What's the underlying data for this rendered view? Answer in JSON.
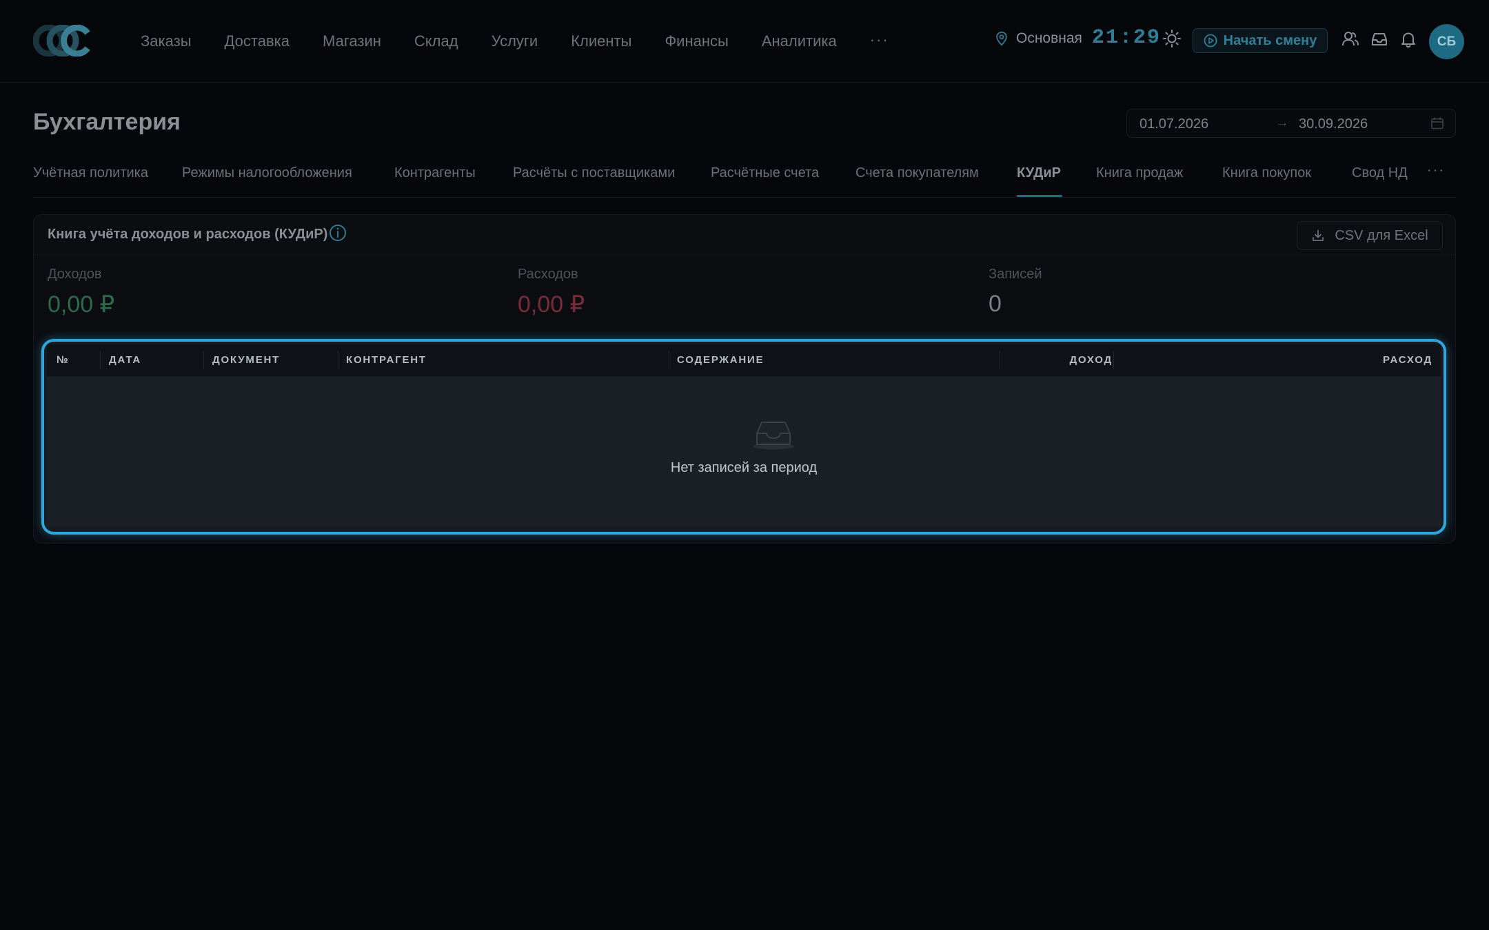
{
  "app": {
    "logo_text": "CCC"
  },
  "nav": {
    "items": [
      "Заказы",
      "Доставка",
      "Магазин",
      "Склад",
      "Услуги",
      "Клиенты",
      "Финансы",
      "Аналитика"
    ],
    "more_label": "···"
  },
  "header": {
    "branch": "Основная",
    "clock": "21:29",
    "start_shift_label": "Начать смену",
    "avatar_initials": "СБ"
  },
  "page": {
    "title": "Бухгалтерия",
    "date_from": "01.07.2026",
    "date_arrow": "→",
    "date_to": "30.09.2026"
  },
  "tabs": {
    "items": [
      "Учётная политика",
      "Режимы налогообложения",
      "Контрагенты",
      "Расчёты с поставщиками",
      "Расчётные счета",
      "Счета покупателям",
      "КУДиР",
      "Книга продаж",
      "Книга покупок",
      "Свод НД"
    ],
    "active": "КУДиР",
    "more_label": "···"
  },
  "panel": {
    "title": "Книга учёта доходов и расходов (КУДиР)",
    "export_label": "CSV для Excel",
    "stats": {
      "income_label": "Доходов",
      "income_value": "0,00 ₽",
      "expense_label": "Расходов",
      "expense_value": "0,00 ₽",
      "count_label": "Записей",
      "count_value": "0"
    }
  },
  "table": {
    "columns": [
      "№",
      "ДАТА",
      "ДОКУМЕНТ",
      "КОНТРАГЕНТ",
      "СОДЕРЖАНИЕ",
      "ДОХОД",
      "РАСХОД"
    ],
    "rows": [],
    "empty_text": "Нет записей за период"
  },
  "colors": {
    "accent": "#2ea8dc",
    "income": "#2b6b4c",
    "expense": "#7a2c3a",
    "brand": "#1e6a82"
  },
  "icons": {
    "logo": "ccc-logo",
    "branch": "map-pin-icon",
    "theme": "sun-icon",
    "shift": "play-circle-icon",
    "staff": "users-icon",
    "inbox": "inbox-icon",
    "notifications": "bell-icon",
    "calendar": "calendar-icon",
    "info": "info-icon",
    "download": "download-icon",
    "empty": "empty-tray-icon"
  }
}
